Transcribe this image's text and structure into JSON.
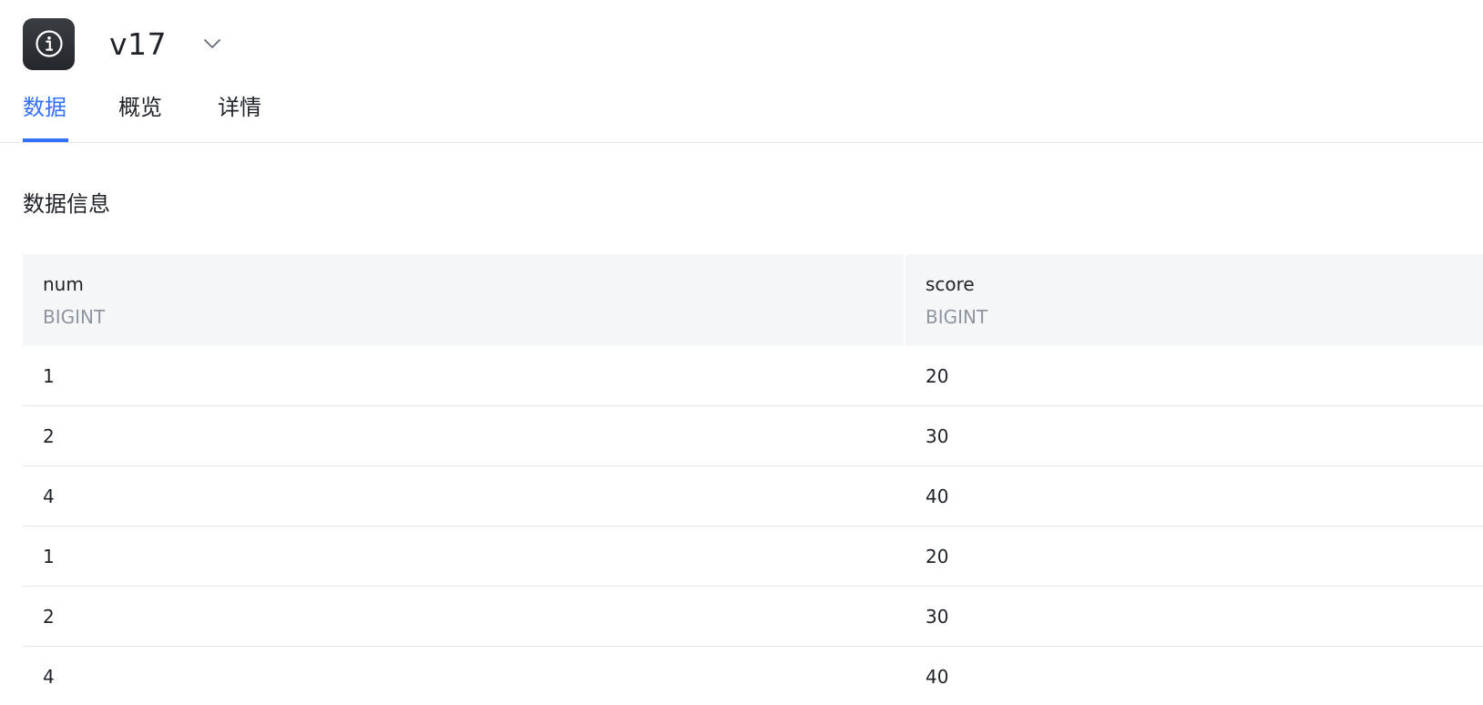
{
  "header": {
    "title": "v17",
    "icon": "info-icon",
    "dropdown_icon": "chevron-down-icon"
  },
  "tabs": [
    {
      "label": "数据",
      "active": true
    },
    {
      "label": "概览",
      "active": false
    },
    {
      "label": "详情",
      "active": false
    }
  ],
  "section": {
    "title": "数据信息"
  },
  "table": {
    "columns": [
      {
        "name": "num",
        "type": "BIGINT"
      },
      {
        "name": "score",
        "type": "BIGINT"
      }
    ],
    "rows": [
      [
        "1",
        "20"
      ],
      [
        "2",
        "30"
      ],
      [
        "4",
        "40"
      ],
      [
        "1",
        "20"
      ],
      [
        "2",
        "30"
      ],
      [
        "4",
        "40"
      ]
    ]
  },
  "colors": {
    "accent": "#3370ff",
    "text": "#1f2329",
    "muted": "#8f959e",
    "header_bg": "#f5f6f7"
  }
}
